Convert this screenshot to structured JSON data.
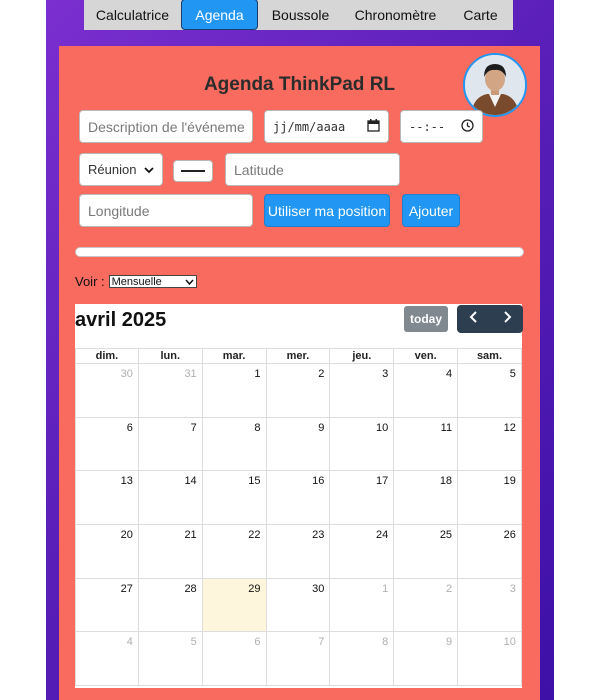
{
  "tabs": [
    {
      "label": "Calculatrice",
      "active": false
    },
    {
      "label": "Agenda",
      "active": true
    },
    {
      "label": "Boussole",
      "active": false
    },
    {
      "label": "Chronomètre",
      "active": false
    },
    {
      "label": "Carte",
      "active": false
    }
  ],
  "app": {
    "title": "Agenda ThinkPad RL"
  },
  "form": {
    "description_placeholder": "Description de l'événement",
    "date_placeholder": "jj/mm/aaaa",
    "time_placeholder": "--:--",
    "type_selected": "Réunion",
    "latitude_placeholder": "Latitude",
    "longitude_placeholder": "Longitude",
    "use_position_label": "Utiliser ma position",
    "add_label": "Ajouter"
  },
  "progress": {
    "value": 0
  },
  "view": {
    "label": "Voir :",
    "selected": "Mensuelle"
  },
  "calendar": {
    "title": "avril 2025",
    "today_label": "today",
    "weekdays": [
      "dim.",
      "lun.",
      "mar.",
      "mer.",
      "jeu.",
      "ven.",
      "sam."
    ],
    "weeks": [
      [
        {
          "d": "30",
          "o": true
        },
        {
          "d": "31",
          "o": true
        },
        {
          "d": "1"
        },
        {
          "d": "2"
        },
        {
          "d": "3"
        },
        {
          "d": "4"
        },
        {
          "d": "5"
        }
      ],
      [
        {
          "d": "6"
        },
        {
          "d": "7"
        },
        {
          "d": "8"
        },
        {
          "d": "9"
        },
        {
          "d": "10"
        },
        {
          "d": "11"
        },
        {
          "d": "12"
        }
      ],
      [
        {
          "d": "13"
        },
        {
          "d": "14"
        },
        {
          "d": "15"
        },
        {
          "d": "16"
        },
        {
          "d": "17"
        },
        {
          "d": "18"
        },
        {
          "d": "19"
        }
      ],
      [
        {
          "d": "20"
        },
        {
          "d": "21"
        },
        {
          "d": "22"
        },
        {
          "d": "23"
        },
        {
          "d": "24"
        },
        {
          "d": "25"
        },
        {
          "d": "26"
        }
      ],
      [
        {
          "d": "27"
        },
        {
          "d": "28"
        },
        {
          "d": "29",
          "t": true
        },
        {
          "d": "30"
        },
        {
          "d": "1",
          "o": true
        },
        {
          "d": "2",
          "o": true
        },
        {
          "d": "3",
          "o": true
        }
      ],
      [
        {
          "d": "4",
          "o": true
        },
        {
          "d": "5",
          "o": true
        },
        {
          "d": "6",
          "o": true
        },
        {
          "d": "7",
          "o": true
        },
        {
          "d": "8",
          "o": true
        },
        {
          "d": "9",
          "o": true
        },
        {
          "d": "10",
          "o": true
        }
      ]
    ]
  },
  "colors": {
    "panel": "#f96b5e",
    "accent": "#2196f3",
    "today_bg": "#fdf6dc",
    "nav_dark": "#2c3e50"
  }
}
